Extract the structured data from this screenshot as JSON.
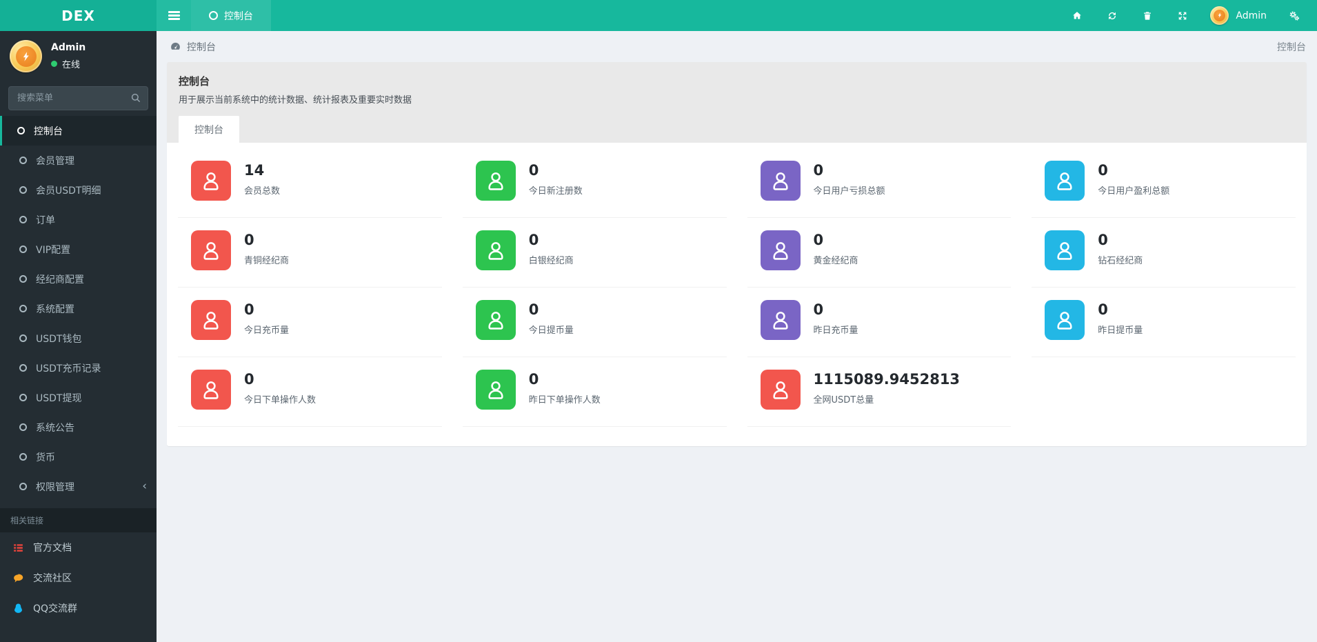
{
  "colors": {
    "red": "#f2564d",
    "green": "#2dc44f",
    "purple": "#7a65c5",
    "cyan": "#23b7e5",
    "teal": "#17b89d"
  },
  "topbar": {
    "brand": "DEX",
    "tab_label": "控制台",
    "user_name": "Admin",
    "icons": [
      "home-icon",
      "refresh-icon",
      "trash-icon",
      "expand-icon",
      "gears-icon"
    ]
  },
  "sidebar": {
    "user_name": "Admin",
    "user_status": "在线",
    "search_placeholder": "搜索菜单",
    "items": [
      {
        "name": "dashboard",
        "label": "控制台",
        "active": true
      },
      {
        "name": "members",
        "label": "会员管理"
      },
      {
        "name": "member-usdt-detail",
        "label": "会员USDT明细"
      },
      {
        "name": "orders",
        "label": "订单"
      },
      {
        "name": "vip-config",
        "label": "VIP配置"
      },
      {
        "name": "broker-config",
        "label": "经纪商配置"
      },
      {
        "name": "system-config",
        "label": "系统配置"
      },
      {
        "name": "usdt-wallet",
        "label": "USDT钱包"
      },
      {
        "name": "usdt-deposit-records",
        "label": "USDT充币记录"
      },
      {
        "name": "usdt-withdraw",
        "label": "USDT提现"
      },
      {
        "name": "system-announcements",
        "label": "系统公告"
      },
      {
        "name": "currency",
        "label": "货币"
      },
      {
        "name": "permissions",
        "label": "权限管理",
        "collapsed": true
      }
    ],
    "links_header": "相关链接",
    "links": [
      {
        "name": "official-docs",
        "label": "官方文档",
        "icon": "list-icon",
        "icon_color": "#e5443c"
      },
      {
        "name": "community",
        "label": "交流社区",
        "icon": "comment-icon",
        "icon_color": "#f7a428"
      },
      {
        "name": "qq-group",
        "label": "QQ交流群",
        "icon": "qq-icon",
        "icon_color": "#12b7f5"
      }
    ]
  },
  "breadcrumb": {
    "left": "控制台",
    "right": "控制台"
  },
  "panel": {
    "title": "控制台",
    "subtitle": "用于展示当前系统中的统计数据、统计报表及重要实时数据",
    "tab": "控制台"
  },
  "stats": [
    {
      "value": "14",
      "label": "会员总数",
      "color": "red"
    },
    {
      "value": "0",
      "label": "今日新注册数",
      "color": "green"
    },
    {
      "value": "0",
      "label": "今日用户亏损总额",
      "color": "purple"
    },
    {
      "value": "0",
      "label": "今日用户盈利总额",
      "color": "cyan"
    },
    {
      "value": "0",
      "label": "青铜经纪商",
      "color": "red"
    },
    {
      "value": "0",
      "label": "白银经纪商",
      "color": "green"
    },
    {
      "value": "0",
      "label": "黄金经纪商",
      "color": "purple"
    },
    {
      "value": "0",
      "label": "钻石经纪商",
      "color": "cyan"
    },
    {
      "value": "0",
      "label": "今日充币量",
      "color": "red"
    },
    {
      "value": "0",
      "label": "今日提币量",
      "color": "green"
    },
    {
      "value": "0",
      "label": "昨日充币量",
      "color": "purple"
    },
    {
      "value": "0",
      "label": "昨日提币量",
      "color": "cyan"
    },
    {
      "value": "0",
      "label": "今日下单操作人数",
      "color": "red"
    },
    {
      "value": "0",
      "label": "昨日下单操作人数",
      "color": "green"
    },
    {
      "value": "1115089.9452813",
      "label": "全网USDT总量",
      "color": "red"
    }
  ]
}
